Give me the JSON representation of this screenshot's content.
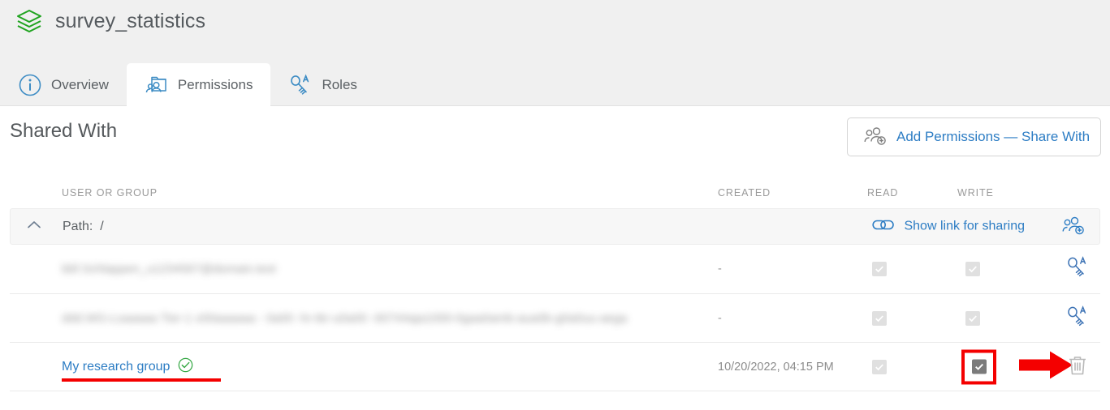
{
  "header": {
    "app_title": "survey_statistics",
    "logo_icon": "layers-stack-icon",
    "logo_color": "#1fa31f"
  },
  "tabs": [
    {
      "label": "Overview",
      "icon": "info-circle-icon",
      "active": false
    },
    {
      "label": "Permissions",
      "icon": "permissions-folder-users-icon",
      "active": true
    },
    {
      "label": "Roles",
      "icon": "key-a-icon",
      "active": false
    }
  ],
  "main": {
    "section_title": "Shared With",
    "add_permissions_button": {
      "label": "Add Permissions — Share With",
      "icon": "add-users-icon"
    },
    "columns": {
      "user_or_group": "USER OR GROUP",
      "created": "CREATED",
      "read": "READ",
      "write": "WRITE"
    },
    "path_row": {
      "chevron_icon": "chevron-up-icon",
      "label_prefix": "Path:",
      "path": "/",
      "share_link_label": "Show link for sharing",
      "share_link_icon": "link-chain-icon",
      "add_user_icon": "add-users-icon"
    },
    "rows": [
      {
        "name": "redacted-user-1",
        "redacted": true,
        "created": "-",
        "read_checked": true,
        "read_state": "disabled",
        "write_checked": true,
        "write_state": "disabled",
        "action_icon": "key-a-icon"
      },
      {
        "name": "redacted-user-2",
        "redacted": true,
        "created": "-",
        "read_checked": true,
        "read_state": "disabled",
        "write_checked": true,
        "write_state": "disabled",
        "action_icon": "key-a-icon"
      },
      {
        "name": "My research group",
        "redacted": false,
        "verified_icon": "check-circle-icon",
        "created": "10/20/2022, 04:15 PM",
        "read_checked": true,
        "read_state": "disabled",
        "write_checked": true,
        "write_state": "active",
        "action_icon": "trash-icon"
      }
    ]
  },
  "annotations": {
    "highlight_box_color": "#f40000",
    "underline_color": "#f40000",
    "arrow_color": "#f40000",
    "arrow_points_to": "trash-icon",
    "highlight_target": "write-checkbox-row-3",
    "underline_target": "My research group"
  },
  "colors": {
    "link_blue": "#2d7dc4",
    "header_bg": "#f0f0f0",
    "text_gray": "#5b6064",
    "muted_gray": "#9a9a9a",
    "green": "#1fa31f"
  }
}
